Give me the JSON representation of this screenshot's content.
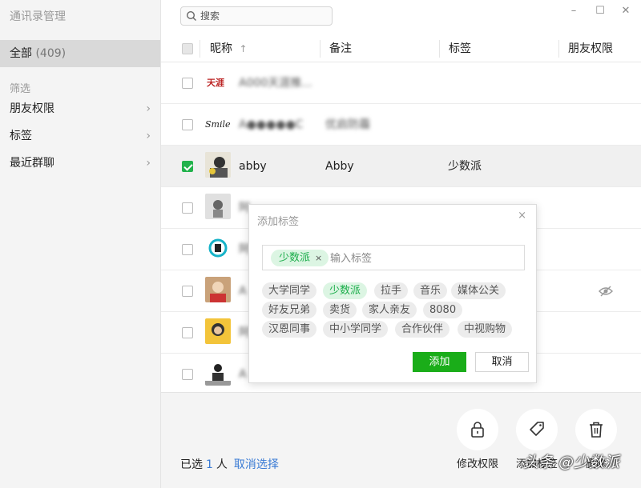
{
  "sidebar": {
    "title": "通讯录管理",
    "all_label": "全部",
    "all_count": "(409)",
    "filter_label": "筛选",
    "items": [
      {
        "label": "朋友权限"
      },
      {
        "label": "标签"
      },
      {
        "label": "最近群聊"
      }
    ]
  },
  "search": {
    "placeholder": "搜索"
  },
  "table": {
    "headers": {
      "name": "昵称",
      "name_sort": "↑",
      "remark": "备注",
      "tags": "标签",
      "permission": "朋友权限"
    },
    "rows": [
      {
        "name": "A000天涯推...",
        "remark": "",
        "tag": "",
        "checked": false
      },
      {
        "name": "A●●●●●C",
        "remark": "优启防霾",
        "tag": "",
        "checked": false
      },
      {
        "name": "abby",
        "remark": "Abby",
        "tag": "少数派",
        "checked": true
      },
      {
        "name": "阿",
        "remark": "",
        "tag": "",
        "checked": false
      },
      {
        "name": "阿",
        "remark": "",
        "tag": "",
        "checked": false
      },
      {
        "name": "A",
        "remark": "",
        "tag": "",
        "checked": false
      },
      {
        "name": "阿",
        "remark": "",
        "tag": "",
        "checked": false
      },
      {
        "name": "A",
        "remark": "",
        "tag": "",
        "checked": false
      }
    ]
  },
  "popup": {
    "title": "添加标签",
    "close": "×",
    "selected_chip": "少数派",
    "chip_remove": "×",
    "input_placeholder": "输入标签",
    "tags": [
      "大学同学",
      "少数派",
      "拉手",
      "音乐",
      "媒体公关",
      "好友兄弟",
      "卖货",
      "家人亲友",
      "8080",
      "汉恩同事",
      "中小学同学",
      "合作伙伴",
      "中视购物"
    ],
    "active_tag": "少数派",
    "add_label": "添加",
    "cancel_label": "取消"
  },
  "footer": {
    "selected_prefix": "已选",
    "selected_count": "1",
    "selected_suffix": "人",
    "cancel_select": "取消选择",
    "actions": [
      {
        "label": "修改权限",
        "icon": "lock-icon"
      },
      {
        "label": "添加标签",
        "icon": "tag-icon"
      },
      {
        "label": "删除",
        "icon": "trash-icon"
      }
    ],
    "watermark": "头条 @少数派"
  },
  "window_controls": {
    "minimize": "–",
    "maximize": "☐",
    "close": "✕"
  },
  "colors": {
    "accent": "#1aad19",
    "link": "#3a7bd5",
    "sidebar_bg": "#f4f4f4",
    "selected_row": "#f0f0f0"
  }
}
